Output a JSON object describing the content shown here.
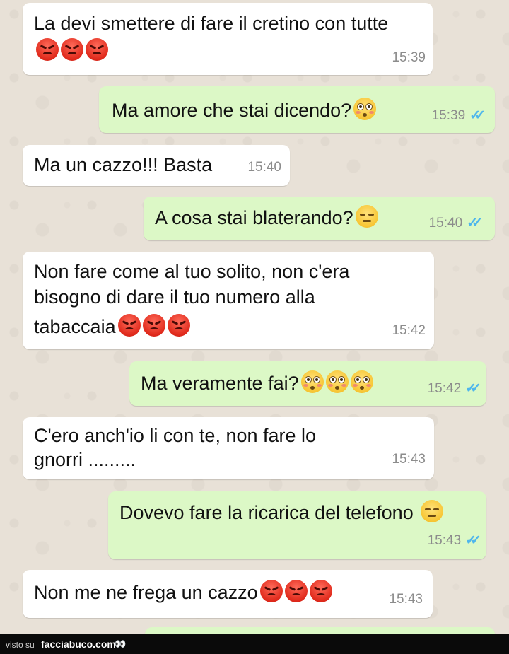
{
  "messages": [
    {
      "direction": "in",
      "text": "La devi smettere di fare il cretino con tutte",
      "line2": "",
      "emojis": [
        "angry-face",
        "angry-face",
        "angry-face"
      ],
      "time": "15:39"
    },
    {
      "direction": "out",
      "text": "Ma amore che stai dicendo?",
      "emojis": [
        "flushed-face"
      ],
      "time": "15:39",
      "status": "read"
    },
    {
      "direction": "in",
      "text": "Ma un cazzo!!! Basta",
      "emojis": [],
      "time": "15:40"
    },
    {
      "direction": "out",
      "text": "A cosa stai blaterando?",
      "emojis": [
        "expressionless-face"
      ],
      "time": "15:40",
      "status": "read"
    },
    {
      "direction": "in",
      "text": "Non fare come al tuo solito, non c'era",
      "line2": "bisogno di dare il tuo numero alla",
      "line3": "tabaccaia",
      "emojis": [
        "angry-face",
        "angry-face",
        "angry-face"
      ],
      "time": "15:42"
    },
    {
      "direction": "out",
      "text": "Ma veramente fai?",
      "emojis": [
        "flushed-face",
        "flushed-face",
        "flushed-face"
      ],
      "time": "15:42",
      "status": "read"
    },
    {
      "direction": "in",
      "text": "C'ero anch'io li con te, non fare lo",
      "line2": "gnorri .........",
      "emojis": [],
      "time": "15:43"
    },
    {
      "direction": "out",
      "text": "Dovevo fare la ricarica del telefono",
      "emojis": [
        "expressionless-face"
      ],
      "time": "15:43",
      "status": "read"
    },
    {
      "direction": "in",
      "text": "Non me ne frega un cazzo",
      "emojis": [
        "angry-face",
        "angry-face",
        "angry-face"
      ],
      "time": "15:43"
    }
  ],
  "ticks": "✓✓",
  "footer": {
    "prefix": "visto su",
    "site": "facciabuco.com",
    "logo": "👀"
  },
  "colors": {
    "incoming_bubble": "#ffffff",
    "outgoing_bubble": "#dcf8c6",
    "read_ticks": "#4fb6ec",
    "wallpaper": "#e8e1d7"
  }
}
